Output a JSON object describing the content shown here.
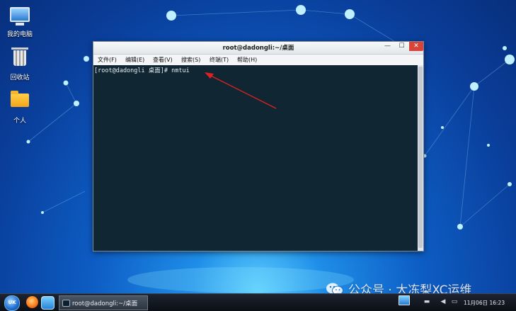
{
  "desktop": {
    "icons": [
      {
        "label": "我的电脑",
        "icon": "computer-icon"
      },
      {
        "label": "回收站",
        "icon": "trash-icon"
      },
      {
        "label": "个人",
        "icon": "folder-icon"
      }
    ]
  },
  "window": {
    "title": "root@dadongli:~/桌面",
    "controls": {
      "minimize": "—",
      "maximize": "☐",
      "close": "✕"
    },
    "menu": [
      "文件(F)",
      "编辑(E)",
      "查看(V)",
      "搜索(S)",
      "终端(T)",
      "帮助(H)"
    ],
    "terminal": {
      "prompt": "[root@dadongli 桌面]# ",
      "command": "nmtui"
    }
  },
  "taskbar": {
    "start_label": "UK",
    "task_label": "root@dadongli:~/桌面",
    "clock": "11月06日 16:23"
  },
  "watermark": {
    "text": "公众号 · 大冻梨XC运维"
  },
  "colors": {
    "terminal_bg": "#102733",
    "close_button": "#d9443a",
    "arrow": "#e02020"
  }
}
